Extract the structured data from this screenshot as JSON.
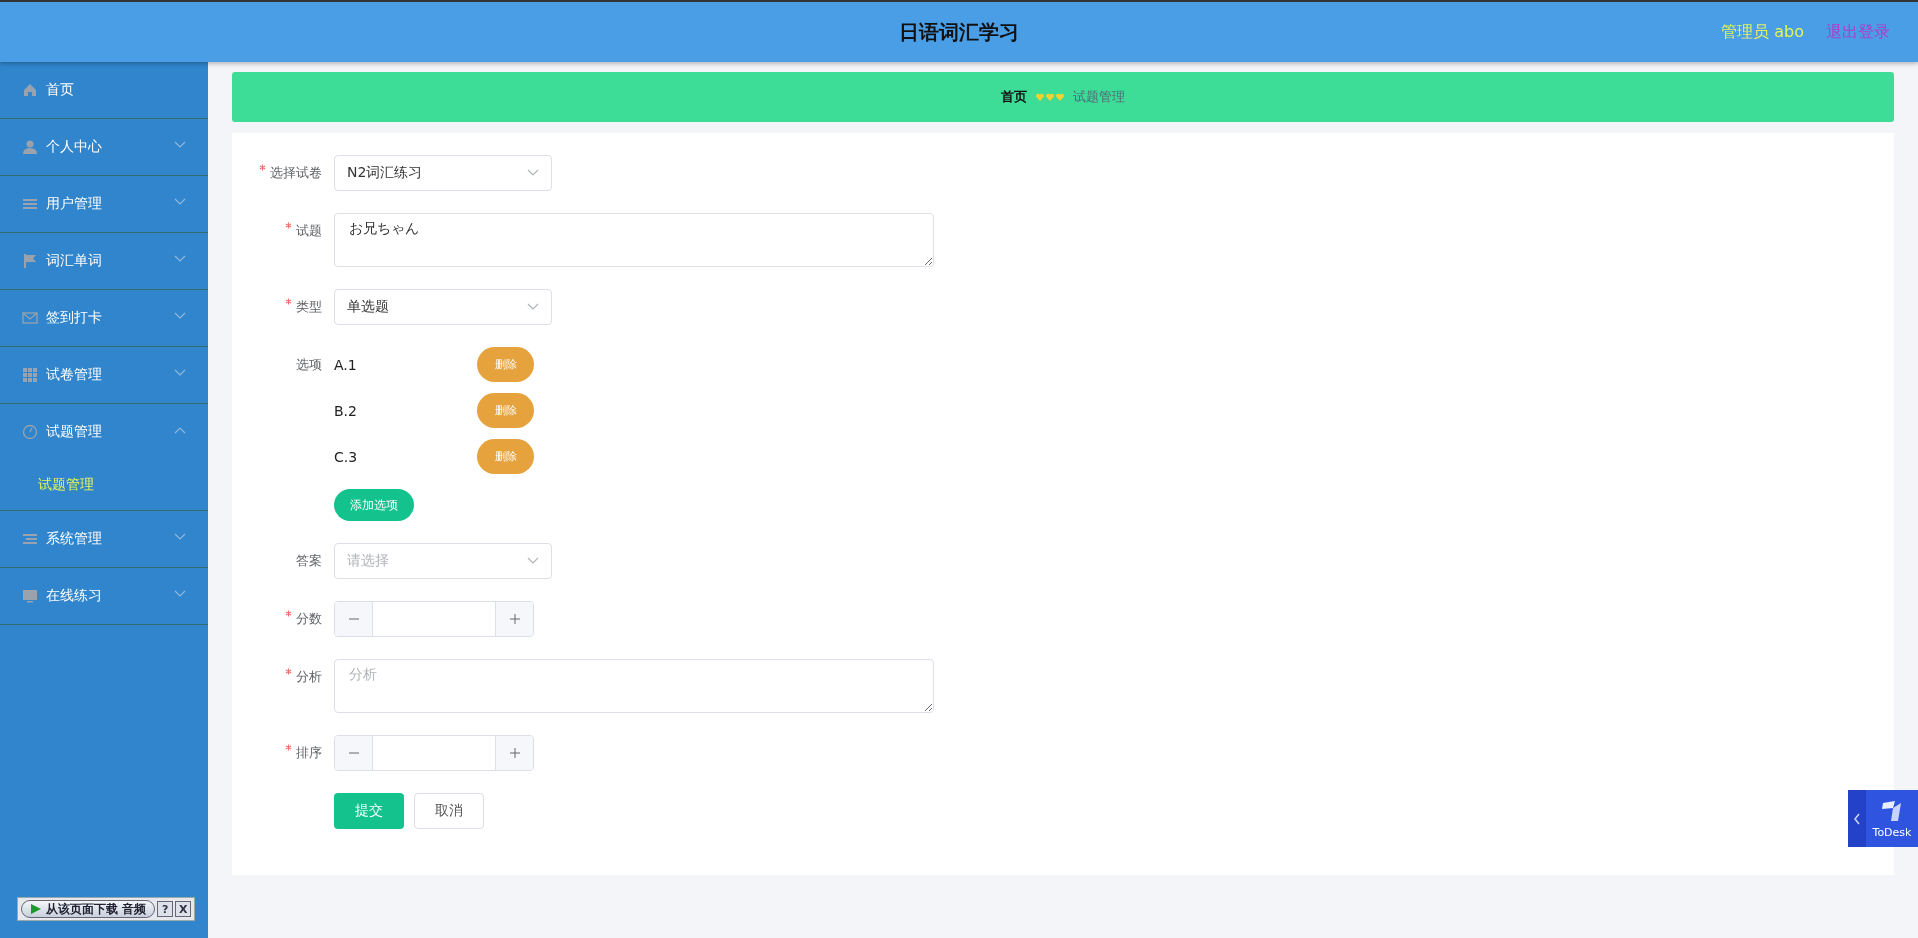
{
  "header": {
    "title": "日语词汇学习",
    "user": "管理员 abo",
    "logout": "退出登录"
  },
  "sidebar": {
    "items": [
      {
        "label": "首页",
        "kind": "link"
      },
      {
        "label": "个人中心",
        "kind": "submenu",
        "expanded": false
      },
      {
        "label": "用户管理",
        "kind": "submenu",
        "expanded": false
      },
      {
        "label": "词汇单词",
        "kind": "submenu",
        "expanded": false
      },
      {
        "label": "签到打卡",
        "kind": "submenu",
        "expanded": false
      },
      {
        "label": "试卷管理",
        "kind": "submenu",
        "expanded": false
      },
      {
        "label": "试题管理",
        "kind": "submenu",
        "expanded": true,
        "children": [
          {
            "label": "试题管理",
            "selected": true
          }
        ]
      },
      {
        "label": "系统管理",
        "kind": "submenu",
        "expanded": false
      },
      {
        "label": "在线练习",
        "kind": "submenu",
        "expanded": false
      }
    ]
  },
  "breadcrumb": [
    "首页",
    "试题管理"
  ],
  "form": {
    "fields": [
      {
        "kind": "select",
        "label": "选择试卷",
        "required": true,
        "value": "N2词汇练习"
      },
      {
        "kind": "textarea",
        "label": "试题",
        "required": true,
        "value": "お兄ちゃん"
      },
      {
        "kind": "select",
        "label": "类型",
        "required": true,
        "value": "单选题"
      },
      {
        "kind": "options",
        "label": "选项",
        "required": false,
        "options": [
          {
            "text": "A.1",
            "button": "删除"
          },
          {
            "text": "B.2",
            "button": "删除"
          },
          {
            "text": "C.3",
            "button": "删除"
          }
        ],
        "add_button": "添加选项"
      },
      {
        "kind": "select",
        "label": "答案",
        "required": false,
        "placeholder": "请选择"
      },
      {
        "kind": "number",
        "label": "分数",
        "required": true
      },
      {
        "kind": "textarea",
        "label": "分析",
        "required": true,
        "placeholder": "分析"
      },
      {
        "kind": "number",
        "label": "排序",
        "required": true
      }
    ],
    "buttons": [
      {
        "label": "提交",
        "kind": "primary"
      },
      {
        "label": "取消",
        "kind": "default"
      }
    ]
  },
  "download_bar": {
    "label": "从该页面下载 音频",
    "help": "?",
    "close": "X"
  },
  "todesk": {
    "label": "ToDesk"
  }
}
